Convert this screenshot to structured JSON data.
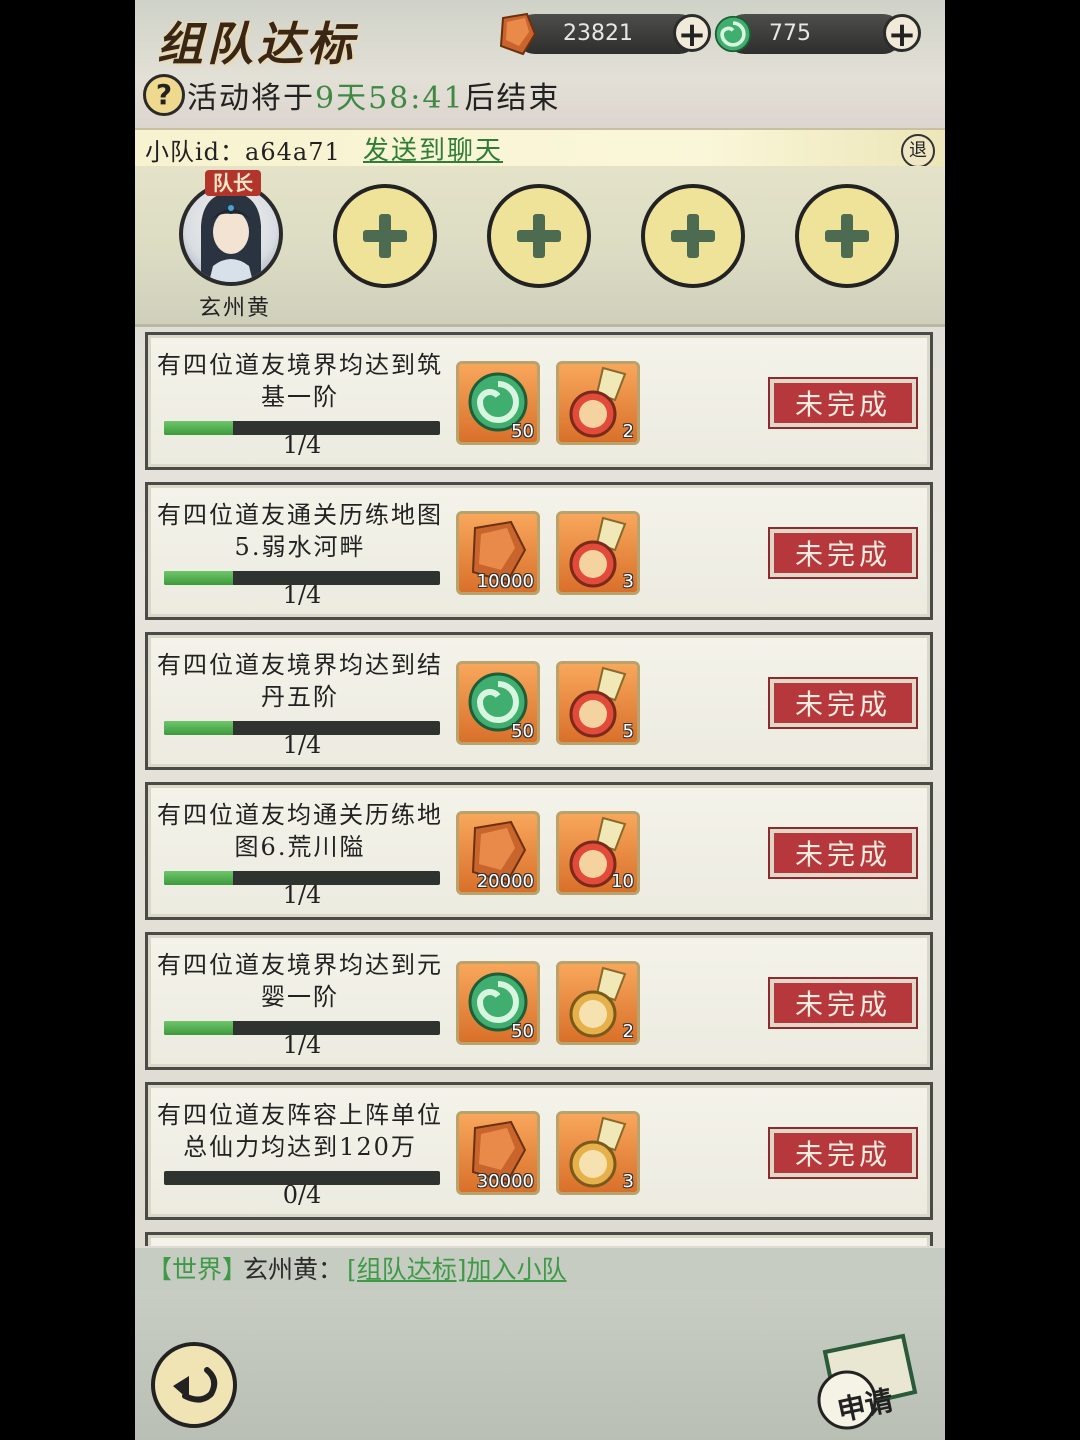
{
  "header": {
    "title": "组队达标",
    "currency_spirit_stone": "23821",
    "currency_jade": "775",
    "timer_prefix": "活动将于",
    "timer_value": "9天58:41",
    "timer_suffix": "后结束"
  },
  "team": {
    "id_label": "小队id：a64a71",
    "send_to_chat": "发送到聊天",
    "quit_label": "退",
    "leader_badge": "队长",
    "leader_name": "玄州黄",
    "empty_slot_count": 4
  },
  "tasks": [
    {
      "desc": "有四位道友境界均达到筑基一阶",
      "progress": "1/4",
      "progress_fraction": 0.25,
      "rewards": [
        {
          "icon": "jade-icon",
          "count": "50"
        },
        {
          "icon": "token-icon",
          "count": "2"
        }
      ],
      "status": "未完成"
    },
    {
      "desc": "有四位道友通关历练地图5.弱水河畔",
      "progress": "1/4",
      "progress_fraction": 0.25,
      "rewards": [
        {
          "icon": "spirit-stone-icon",
          "count": "10000"
        },
        {
          "icon": "token-icon",
          "count": "3"
        }
      ],
      "status": "未完成"
    },
    {
      "desc": "有四位道友境界均达到结丹五阶",
      "progress": "1/4",
      "progress_fraction": 0.25,
      "rewards": [
        {
          "icon": "jade-icon",
          "count": "50"
        },
        {
          "icon": "token-icon",
          "count": "5"
        }
      ],
      "status": "未完成"
    },
    {
      "desc": "有四位道友均通关历练地图6.荒川隘",
      "progress": "1/4",
      "progress_fraction": 0.25,
      "rewards": [
        {
          "icon": "spirit-stone-icon",
          "count": "20000"
        },
        {
          "icon": "token-icon",
          "count": "10"
        }
      ],
      "status": "未完成"
    },
    {
      "desc": "有四位道友境界均达到元婴一阶",
      "progress": "1/4",
      "progress_fraction": 0.25,
      "rewards": [
        {
          "icon": "jade-icon",
          "count": "50"
        },
        {
          "icon": "gold-token-icon",
          "count": "2"
        }
      ],
      "status": "未完成"
    },
    {
      "desc": "有四位道友阵容上阵单位总仙力均达到120万",
      "progress": "0/4",
      "progress_fraction": 0.0,
      "rewards": [
        {
          "icon": "spirit-stone-icon",
          "count": "30000"
        },
        {
          "icon": "gold-token-icon",
          "count": "3"
        }
      ],
      "status": "未完成"
    }
  ],
  "chat": {
    "channel": "【世界】",
    "user": "玄州黄：",
    "message": "[组队达标]加入小队"
  },
  "bottom": {
    "apply_label": "申请"
  },
  "colors": {
    "accent_green": "#3f9a48",
    "status_red": "#b6383c",
    "slot_yellow": "#efe39a"
  }
}
